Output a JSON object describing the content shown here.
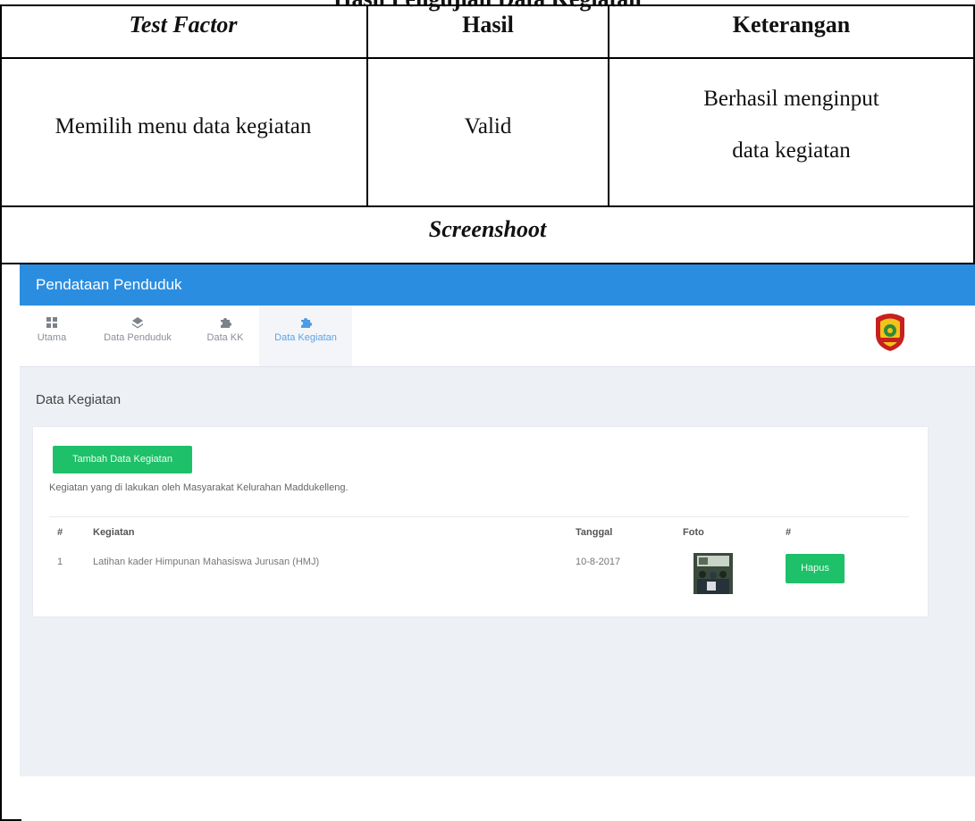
{
  "document": {
    "cut_title": "Hasil Pengujian Data Kegiatan",
    "headers": {
      "test_factor": "Test Factor",
      "hasil": "Hasil",
      "keterangan": "Keterangan"
    },
    "row": {
      "test_factor": "Memilih menu data kegiatan",
      "hasil": "Valid",
      "keterangan_line1": "Berhasil menginput",
      "keterangan_line2": "data kegiatan"
    },
    "screenshot_header": "Screenshoot"
  },
  "app": {
    "title": "Pendataan Penduduk",
    "nav": [
      {
        "label": "Utama",
        "icon": "grid-icon"
      },
      {
        "label": "Data Penduduk",
        "icon": "layers-icon"
      },
      {
        "label": "Data KK",
        "icon": "puzzle-icon"
      },
      {
        "label": "Data Kegiatan",
        "icon": "puzzle-icon",
        "active": true
      }
    ],
    "page_title": "Data Kegiatan",
    "add_button": "Tambah Data Kegiatan",
    "description": "Kegiatan yang di lakukan oleh Masyarakat Kelurahan Maddukelleng.",
    "table": {
      "columns": [
        "#",
        "Kegiatan",
        "Tanggal",
        "Foto",
        "#"
      ],
      "rows": [
        {
          "no": "1",
          "kegiatan": "Latihan kader Himpunan Mahasiswa Jurusan (HMJ)",
          "tanggal": "10-8-2017",
          "action": "Hapus"
        }
      ]
    },
    "colors": {
      "appbar": "#2a8de0",
      "button": "#1ec069",
      "active_nav": "#5da3e6"
    }
  }
}
